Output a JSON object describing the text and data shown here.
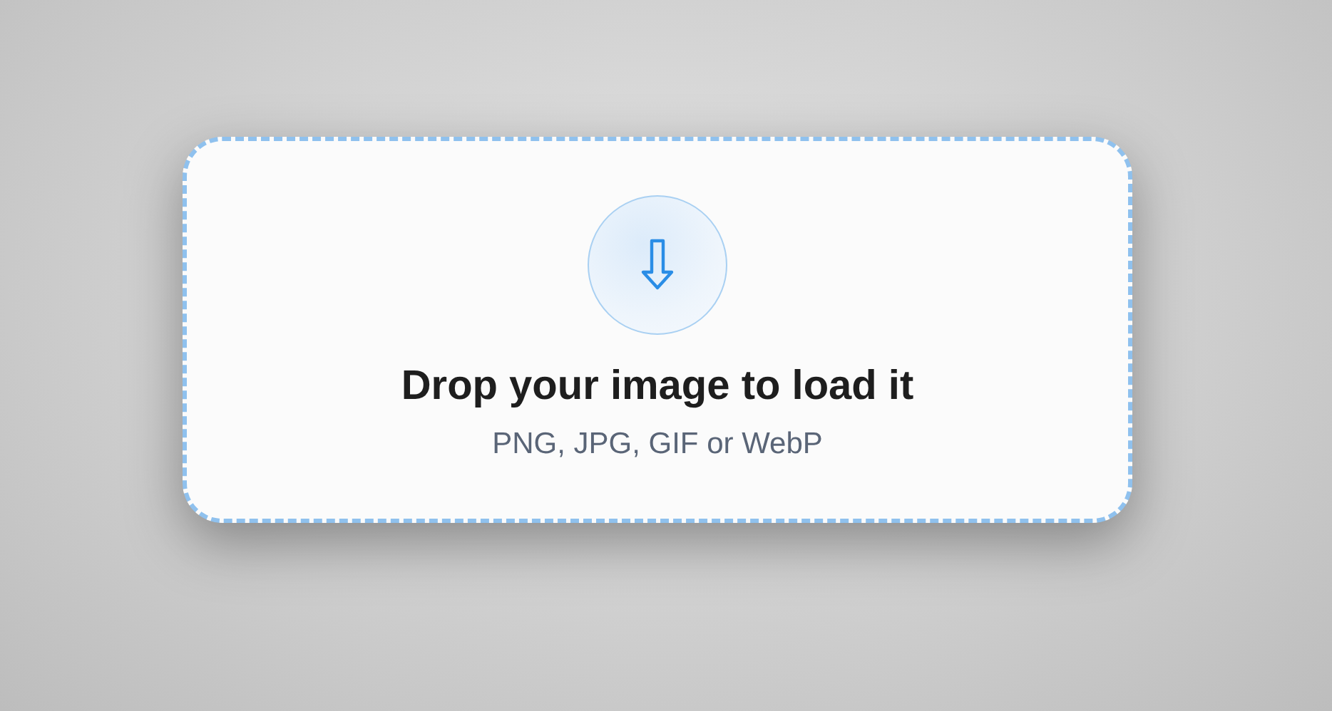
{
  "drop_zone": {
    "title": "Drop your image to load it",
    "subtitle": "PNG, JPG, GIF or WebP"
  }
}
